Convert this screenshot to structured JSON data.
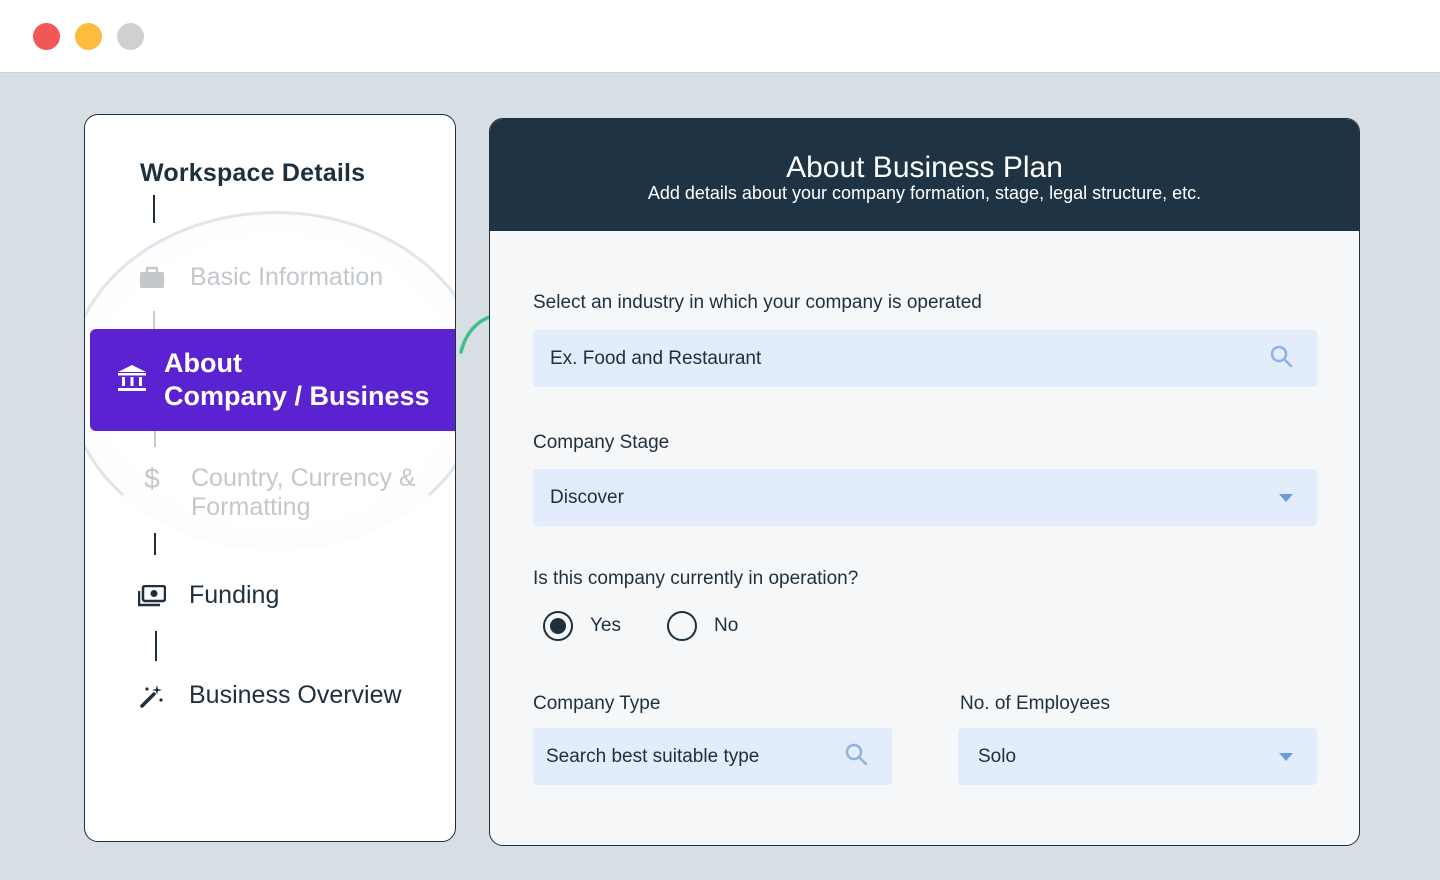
{
  "window": {
    "controls": [
      "close",
      "minimize",
      "maximize"
    ]
  },
  "sidebar": {
    "title": "Workspace Details",
    "steps": [
      {
        "label": "Basic Information",
        "icon": "briefcase-icon",
        "state": "faded"
      },
      {
        "label_line1": "About",
        "label_line2": "Company / Business",
        "icon": "bank-icon",
        "state": "active"
      },
      {
        "label_line1": "Country, Currency &",
        "label_line2": "Formatting",
        "icon": "dollar-icon",
        "state": "faded"
      },
      {
        "label": "Funding",
        "icon": "money-icon",
        "state": "normal"
      },
      {
        "label": "Business Overview",
        "icon": "magic-wand-icon",
        "state": "normal"
      }
    ]
  },
  "main": {
    "title": "About Business Plan",
    "subtitle": "Add details about your company formation, stage, legal structure, etc.",
    "industry": {
      "label": "Select an industry in which your company is operated",
      "placeholder": "Ex. Food and Restaurant"
    },
    "stage": {
      "label": "Company Stage",
      "value": "Discover"
    },
    "operation": {
      "label": "Is this company currently in operation?",
      "options": [
        "Yes",
        "No"
      ],
      "selected": "Yes"
    },
    "company_type": {
      "label": "Company Type",
      "placeholder": "Search best suitable type"
    },
    "employees": {
      "label": "No. of Employees",
      "value": "Solo"
    }
  },
  "colors": {
    "accent": "#5a22d0",
    "header": "#1e3444",
    "field_bg": "#e3ecfa",
    "arrow": "#3fbf8a"
  }
}
